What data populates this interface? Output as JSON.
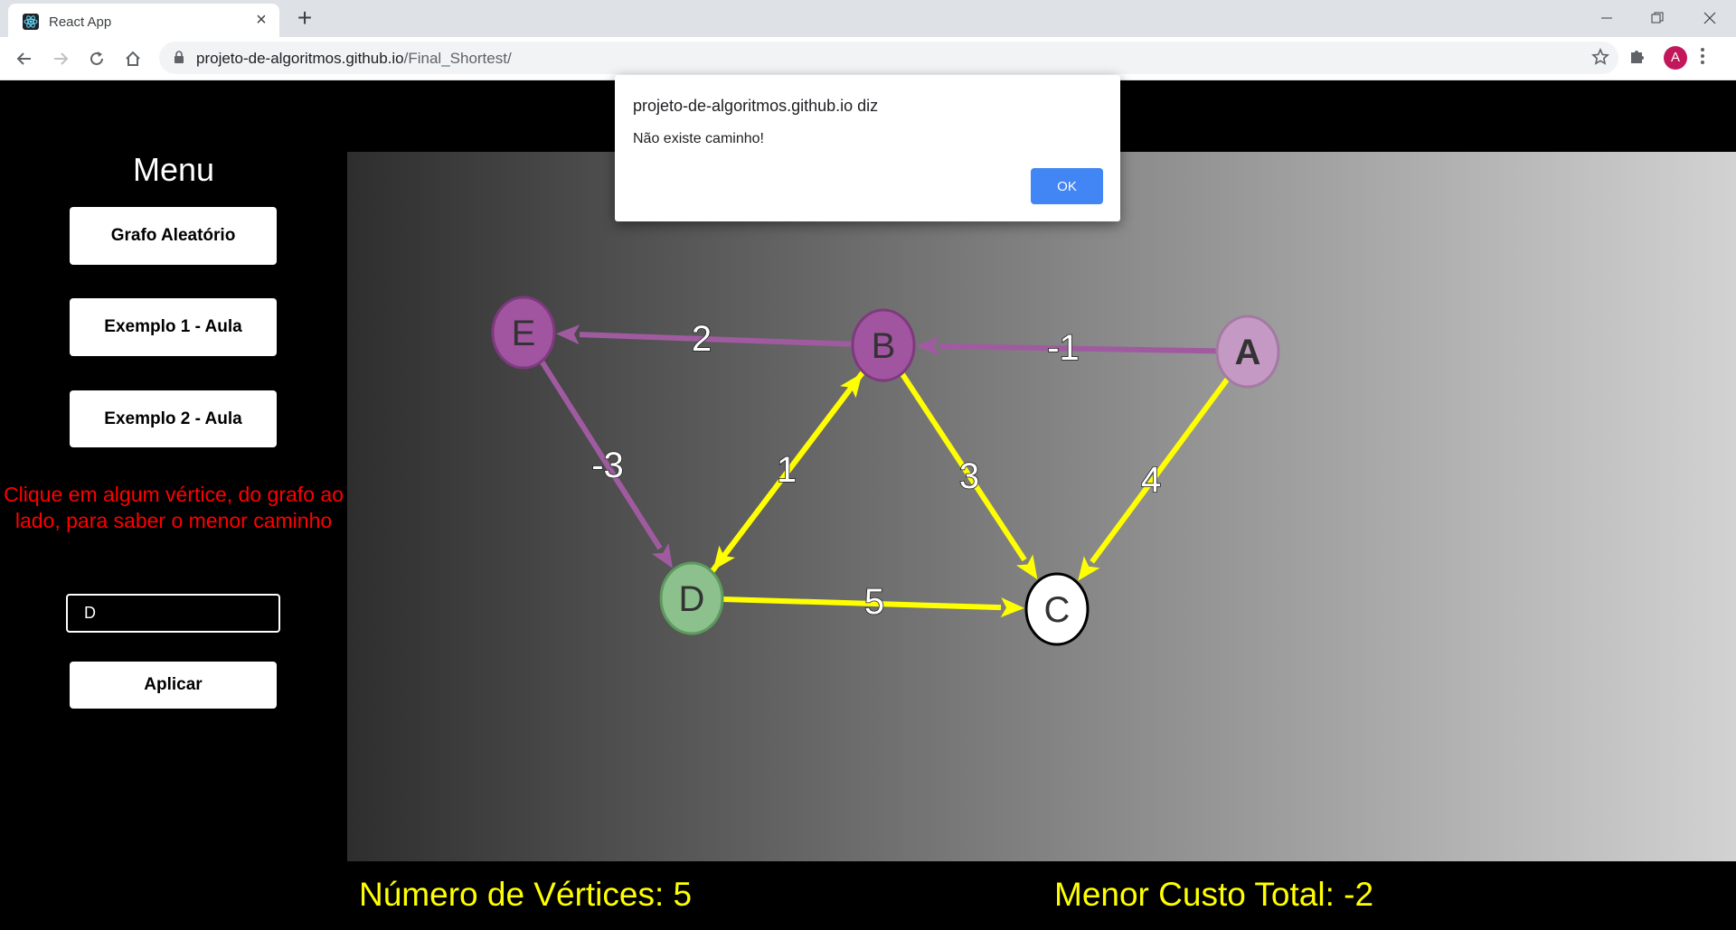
{
  "browser": {
    "tab_title": "React App",
    "tab_close": "×",
    "new_tab": "+",
    "url_host": "projeto-de-algoritmos.github.io",
    "url_path": "/Final_Shortest/",
    "avatar_letter": "A",
    "avatar_color": "#c2185b"
  },
  "menu": {
    "title": "Menu",
    "random_graph": "Grafo Aleatório",
    "example1": "Exemplo 1 - Aula",
    "example2": "Exemplo 2 - Aula",
    "hint": "Clique em algum vértice, do grafo ao lado, para saber o menor caminho",
    "vertex_input_value": "D",
    "apply": "Aplicar"
  },
  "stats": {
    "vertex_count": "Número de Vértices: 5",
    "min_cost": "Menor Custo Total: -2"
  },
  "dialog": {
    "title": "projeto-de-algoritmos.github.io diz",
    "message": "Não existe caminho!",
    "ok": "OK"
  },
  "graph": {
    "colors": {
      "purple_edge": "#a05ba0",
      "yellow_edge": "#ffff00",
      "purple_node": "#a155a1",
      "light_purple_node": "#c49ac4",
      "green_node": "#8cc08c",
      "white_node": "#ffffff"
    },
    "nodes": [
      {
        "id": "E",
        "label": "E",
        "color": "purple_node"
      },
      {
        "id": "B",
        "label": "B",
        "color": "purple_node"
      },
      {
        "id": "A",
        "label": "A",
        "color": "light_purple_node"
      },
      {
        "id": "D",
        "label": "D",
        "color": "green_node"
      },
      {
        "id": "C",
        "label": "C",
        "color": "white_node"
      }
    ],
    "edges": [
      {
        "from": "B",
        "to": "E",
        "weight": "2",
        "color": "purple_edge"
      },
      {
        "from": "A",
        "to": "B",
        "weight": "-1",
        "color": "purple_edge"
      },
      {
        "from": "E",
        "to": "D",
        "weight": "-3",
        "color": "purple_edge"
      },
      {
        "from": "D",
        "to": "B",
        "weight": "1",
        "color": "yellow_edge"
      },
      {
        "from": "B",
        "to": "D",
        "weight": "",
        "color": "yellow_edge"
      },
      {
        "from": "B",
        "to": "C",
        "weight": "3",
        "color": "yellow_edge"
      },
      {
        "from": "A",
        "to": "C",
        "weight": "4",
        "color": "yellow_edge"
      },
      {
        "from": "D",
        "to": "C",
        "weight": "5",
        "color": "yellow_edge"
      }
    ]
  }
}
